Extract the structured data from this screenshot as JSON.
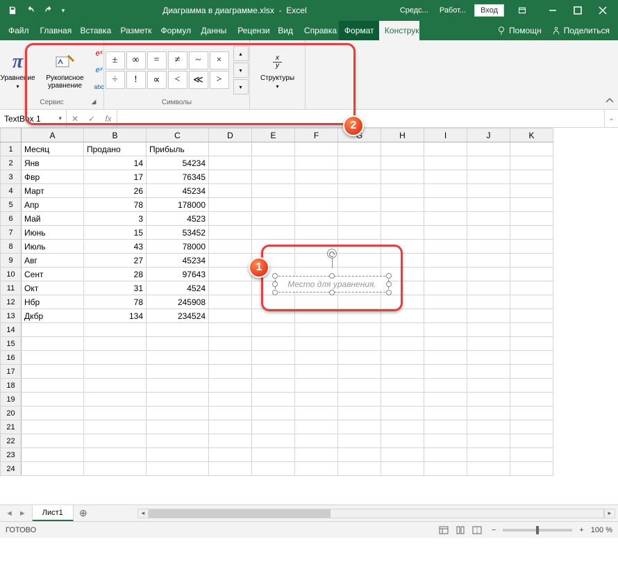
{
  "titlebar": {
    "filename": "Диаграмма в диаграмме.xlsx",
    "appname": "Excel",
    "extra1": "Средс...",
    "extra2": "Работ...",
    "login": "Вход"
  },
  "tabs": {
    "file": "Файл",
    "home": "Главная",
    "insert": "Вставка",
    "layout": "Разметк",
    "formulas": "Формул",
    "data": "Данны",
    "review": "Рецензи",
    "view": "Вид",
    "help": "Справка",
    "format": "Формат",
    "constructor": "Конструктор",
    "assist": "Помощн",
    "share": "Поделиться"
  },
  "ribbon": {
    "service": {
      "equation": "Уравнение",
      "ink_equation": "Рукописное уравнение",
      "label": "Сервис"
    },
    "symbols": {
      "items": [
        "±",
        "∞",
        "=",
        "≠",
        "~",
        "×",
        "÷",
        "!",
        "∝",
        "<",
        "≪",
        ">"
      ],
      "label": "Символы"
    },
    "structures": {
      "label_btn": "Структуры",
      "frac_top": "x",
      "frac_bottom": "y"
    }
  },
  "formula_bar": {
    "name_box": "TextBox 1",
    "fx": "fx"
  },
  "columns": [
    "A",
    "B",
    "C",
    "D",
    "E",
    "F",
    "G",
    "H",
    "I",
    "J",
    "K"
  ],
  "rows_visible": 24,
  "headers": {
    "A": "Месяц",
    "B": "Продано",
    "C": "Прибыль"
  },
  "rows": [
    {
      "A": "Янв",
      "B": "14",
      "C": "54234"
    },
    {
      "A": "Фвр",
      "B": "17",
      "C": "76345"
    },
    {
      "A": "Март",
      "B": "26",
      "C": "45234"
    },
    {
      "A": "Апр",
      "B": "78",
      "C": "178000"
    },
    {
      "A": "Май",
      "B": "3",
      "C": "4523"
    },
    {
      "A": "Июнь",
      "B": "15",
      "C": "53452"
    },
    {
      "A": "Июль",
      "B": "43",
      "C": "78000"
    },
    {
      "A": "Авг",
      "B": "27",
      "C": "45234"
    },
    {
      "A": "Сент",
      "B": "28",
      "C": "97643"
    },
    {
      "A": "Окт",
      "B": "31",
      "C": "4524"
    },
    {
      "A": "Нбр",
      "B": "78",
      "C": "245908"
    },
    {
      "A": "Дкбр",
      "B": "134",
      "C": "234524"
    }
  ],
  "textbox": {
    "placeholder": "Место для уравнения."
  },
  "sheet_tabs": {
    "sheet1": "Лист1"
  },
  "status": {
    "ready": "ГОТОВО",
    "zoom": "100 %"
  },
  "badges": {
    "one": "1",
    "two": "2"
  }
}
